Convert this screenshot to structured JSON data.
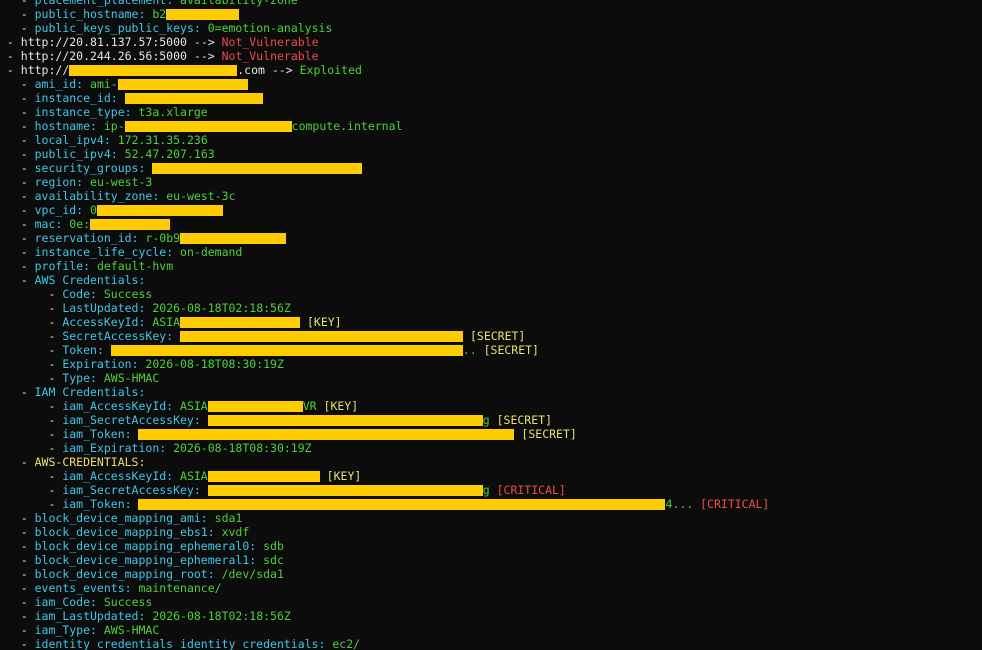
{
  "colors": {
    "background": "#0c0c0c",
    "key": "#3fc6e8",
    "value": "#4cd13a",
    "tag": "#e8e06e",
    "critical": "#f04a4a",
    "redaction": "#ffcc00"
  },
  "lines": [
    {
      "indent": 3,
      "key": "placement_placement",
      "value": "availability-zone"
    },
    {
      "indent": 3,
      "key": "public_hostname",
      "value": "b2",
      "redact": 73
    },
    {
      "indent": 3,
      "key": "public_keys_public_keys",
      "value": "0=emotion-analysis"
    },
    {
      "indent": 1,
      "url": "http://20.81.137.57:5000",
      "arrow": "-->",
      "status": "Not_Vulnerable",
      "status_class": "notvuln"
    },
    {
      "indent": 1,
      "url": "http://20.244.26.56:5000",
      "arrow": "-->",
      "status": "Not_Vulnerable",
      "status_class": "notvuln"
    },
    {
      "indent": 1,
      "url": "http://",
      "url_redact": 168,
      "url_tail": ".com",
      "arrow": "-->",
      "status": "Exploited",
      "status_class": "val"
    },
    {
      "indent": 3,
      "key": "ami_id",
      "value": "ami-",
      "redact": 130
    },
    {
      "indent": 3,
      "key": "instance_id",
      "value": "",
      "redact": 138
    },
    {
      "indent": 3,
      "key": "instance_type",
      "value": "t3a.xlarge"
    },
    {
      "indent": 3,
      "key": "hostname",
      "value": "ip-",
      "redact": 167,
      "value_tail": "compute.internal"
    },
    {
      "indent": 3,
      "key": "local_ipv4",
      "value": "172.31.35.236"
    },
    {
      "indent": 3,
      "key": "public_ipv4",
      "value": "52.47.207.163"
    },
    {
      "indent": 3,
      "key": "security_groups",
      "value": "",
      "redact": 210
    },
    {
      "indent": 3,
      "key": "region",
      "value": "eu-west-3"
    },
    {
      "indent": 3,
      "key": "availability_zone",
      "value": "eu-west-3c"
    },
    {
      "indent": 3,
      "key": "vpc_id",
      "value": "0",
      "redact": 126
    },
    {
      "indent": 3,
      "key": "mac",
      "value": "0e:",
      "redact": 80
    },
    {
      "indent": 3,
      "key": "reservation_id",
      "value": "r-0b9",
      "redact": 106
    },
    {
      "indent": 3,
      "key": "instance_life_cycle",
      "value": "on-demand"
    },
    {
      "indent": 3,
      "key": "profile",
      "value": "default-hvm"
    },
    {
      "indent": 3,
      "key": "AWS Credentials",
      "value": ""
    },
    {
      "indent": 7,
      "key": "Code",
      "value": "Success"
    },
    {
      "indent": 7,
      "key": "LastUpdated",
      "value": "2026-08-18T02:18:56Z"
    },
    {
      "indent": 7,
      "key": "AccessKeyId",
      "value": "ASIA",
      "redact": 120,
      "tag": "[KEY]",
      "tag_class": "tag"
    },
    {
      "indent": 7,
      "key": "SecretAccessKey",
      "value": "",
      "redact": 283,
      "tag": "[SECRET]",
      "tag_class": "tag"
    },
    {
      "indent": 7,
      "key": "Token",
      "value": "",
      "redact": 352,
      "value_tail": "..",
      "tag": "[SECRET]",
      "tag_class": "tag"
    },
    {
      "indent": 7,
      "key": "Expiration",
      "value": "2026-08-18T08:30:19Z"
    },
    {
      "indent": 7,
      "key": "Type",
      "value": "AWS-HMAC"
    },
    {
      "indent": 3,
      "key": "IAM Credentials",
      "value": ""
    },
    {
      "indent": 7,
      "key": "iam_AccessKeyId",
      "value": "ASIA",
      "redact": 95,
      "value_tail": "VR",
      "tag": "[KEY]",
      "tag_class": "tag"
    },
    {
      "indent": 7,
      "key": "iam_SecretAccessKey",
      "value": "",
      "redact": 275,
      "value_tail": "g",
      "tag": "[SECRET]",
      "tag_class": "tag"
    },
    {
      "indent": 7,
      "key": "iam_Token",
      "value": "",
      "redact": 376,
      "tag": "[SECRET]",
      "tag_class": "tag"
    },
    {
      "indent": 7,
      "key": "iam_Expiration",
      "value": "2026-08-18T08:30:19Z"
    },
    {
      "indent": 3,
      "key": "AWS-CREDENTIALS",
      "key_class": "yellow",
      "value": ""
    },
    {
      "indent": 7,
      "key": "iam_AccessKeyId",
      "value": "ASIA",
      "redact": 112,
      "tag": "[KEY]",
      "tag_class": "tag"
    },
    {
      "indent": 7,
      "key": "iam_SecretAccessKey",
      "value": "",
      "redact": 275,
      "value_tail": "g",
      "tag": "[CRITICAL]",
      "tag_class": "crit"
    },
    {
      "indent": 7,
      "key": "iam_Token",
      "value": "",
      "redact": 527,
      "value_tail": "4...",
      "tag": "[CRITICAL]",
      "tag_class": "crit"
    },
    {
      "indent": 3,
      "key": "block_device_mapping_ami",
      "value": "sda1"
    },
    {
      "indent": 3,
      "key": "block_device_mapping_ebs1",
      "value": "xvdf"
    },
    {
      "indent": 3,
      "key": "block_device_mapping_ephemeral0",
      "value": "sdb"
    },
    {
      "indent": 3,
      "key": "block_device_mapping_ephemeral1",
      "value": "sdc"
    },
    {
      "indent": 3,
      "key": "block_device_mapping_root",
      "value": "/dev/sda1"
    },
    {
      "indent": 3,
      "key": "events_events",
      "value": "maintenance/"
    },
    {
      "indent": 3,
      "key": "iam_Code",
      "value": "Success"
    },
    {
      "indent": 3,
      "key": "iam_LastUpdated",
      "value": "2026-08-18T02:18:56Z"
    },
    {
      "indent": 3,
      "key": "iam_Type",
      "value": "AWS-HMAC"
    },
    {
      "indent": 3,
      "key": "identity_credentials_identity_credentials",
      "value": "ec2/"
    }
  ]
}
